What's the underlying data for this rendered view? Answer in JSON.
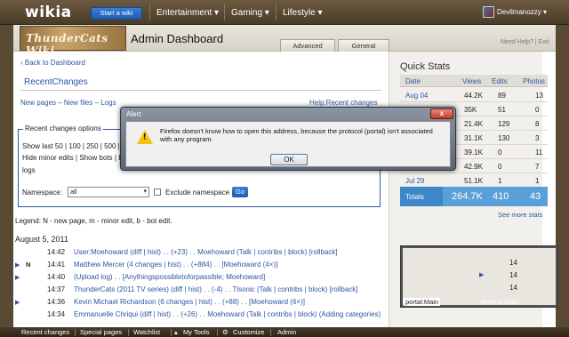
{
  "topbar": {
    "logo": "wikia",
    "start_wiki": "Start a wiki",
    "hubs": [
      "Entertainment ▾",
      "Gaming ▾",
      "Lifestyle ▾"
    ],
    "username": "Devilmanozzy ▾"
  },
  "header": {
    "wiki_logo": "ThunderCats Wiki",
    "title": "Admin Dashboard",
    "tabs": [
      "Advanced",
      "General"
    ],
    "help": "Need Help? | Exit"
  },
  "main": {
    "back": "Back to Dashboard",
    "rc_title": "RecentChanges",
    "links": "New pages – New files – Logs",
    "help_rc": "Help:Recent changes",
    "options_legend": "Recent changes options",
    "opt_line1": "Show last 50 | 100 | 250 | 500 | ...",
    "opt_line2": "Hide minor edits | Show bots | Hid ...",
    "opt_line3": "logs",
    "namespace_label": "Namespace:",
    "namespace_value": "all",
    "exclude_label": "Exclude namespace",
    "go": "Go",
    "legend_line": "Legend: N - new page, m - minor edit, b - bot edit.",
    "date": "August 5, 2011",
    "rows": [
      {
        "flag": "",
        "arrow": "",
        "time": "14:42",
        "text": "User:Moehoward (diff | hist) . . (+23) . . Moehoward (Talk | contribs | block) [rollback]"
      },
      {
        "flag": "N",
        "arrow": "▶",
        "time": "14:41",
        "text": "Matthew Mercer (4 changes | hist) . . (+884) . . [Moehoward (4×)]"
      },
      {
        "flag": "",
        "arrow": "▶",
        "time": "14:40",
        "text": "(Upload log) . . [Anythingspossibletoforpassible; Moehoward]"
      },
      {
        "flag": "",
        "arrow": "",
        "time": "14:37",
        "text": "ThunderCats (2011 TV series) (diff | hist) . . (-4) . . Tlsonic (Talk | contribs | block) [rollback]"
      },
      {
        "flag": "",
        "arrow": "▶",
        "time": "14:36",
        "text": "Kevin Michael Richardson (6 changes | hist) . . (+88) . . [Moehoward (6×)]"
      },
      {
        "flag": "",
        "arrow": "",
        "time": "14:34",
        "text": "Emmanuelle Chriqui (diff | hist) . . (+26) . . Moehoward (Talk | contribs | block) (Adding categories)"
      }
    ]
  },
  "quick_stats": {
    "title": "Quick Stats",
    "columns": [
      "Date",
      "Views",
      "Edits",
      "Photos"
    ],
    "rows": [
      {
        "date": "Aug 04",
        "views": "44.2K",
        "edits": "89",
        "photos": "13"
      },
      {
        "date": "",
        "views": "35K",
        "edits": "51",
        "photos": "0"
      },
      {
        "date": "",
        "views": "21.4K",
        "edits": "129",
        "photos": "8"
      },
      {
        "date": "",
        "views": "31.1K",
        "edits": "130",
        "photos": "3"
      },
      {
        "date": "",
        "views": "39.1K",
        "edits": "0",
        "photos": "11"
      },
      {
        "date": "",
        "views": "42.9K",
        "edits": "0",
        "photos": "7"
      },
      {
        "date": "Jul 29",
        "views": "51.1K",
        "edits": "1",
        "photos": "1"
      }
    ],
    "totals_label": "Totals",
    "totals": {
      "views": "264.7K",
      "edits": "410",
      "photos": "43"
    },
    "see_more": "See more stats"
  },
  "thumb": {
    "left_label": "portal:Main",
    "right_label": "Recent chan",
    "values": [
      "14",
      "14",
      "14"
    ]
  },
  "dialog": {
    "title": "Alert",
    "close": "x",
    "message": "Firefox doesn't know how to open this address, because the protocol (portal) isn't associated with any program.",
    "ok": "OK"
  },
  "toolbar": {
    "items": [
      "Recent changes",
      "Special pages",
      "Watchlist",
      "My Tools",
      "Customize",
      "Admin"
    ]
  }
}
